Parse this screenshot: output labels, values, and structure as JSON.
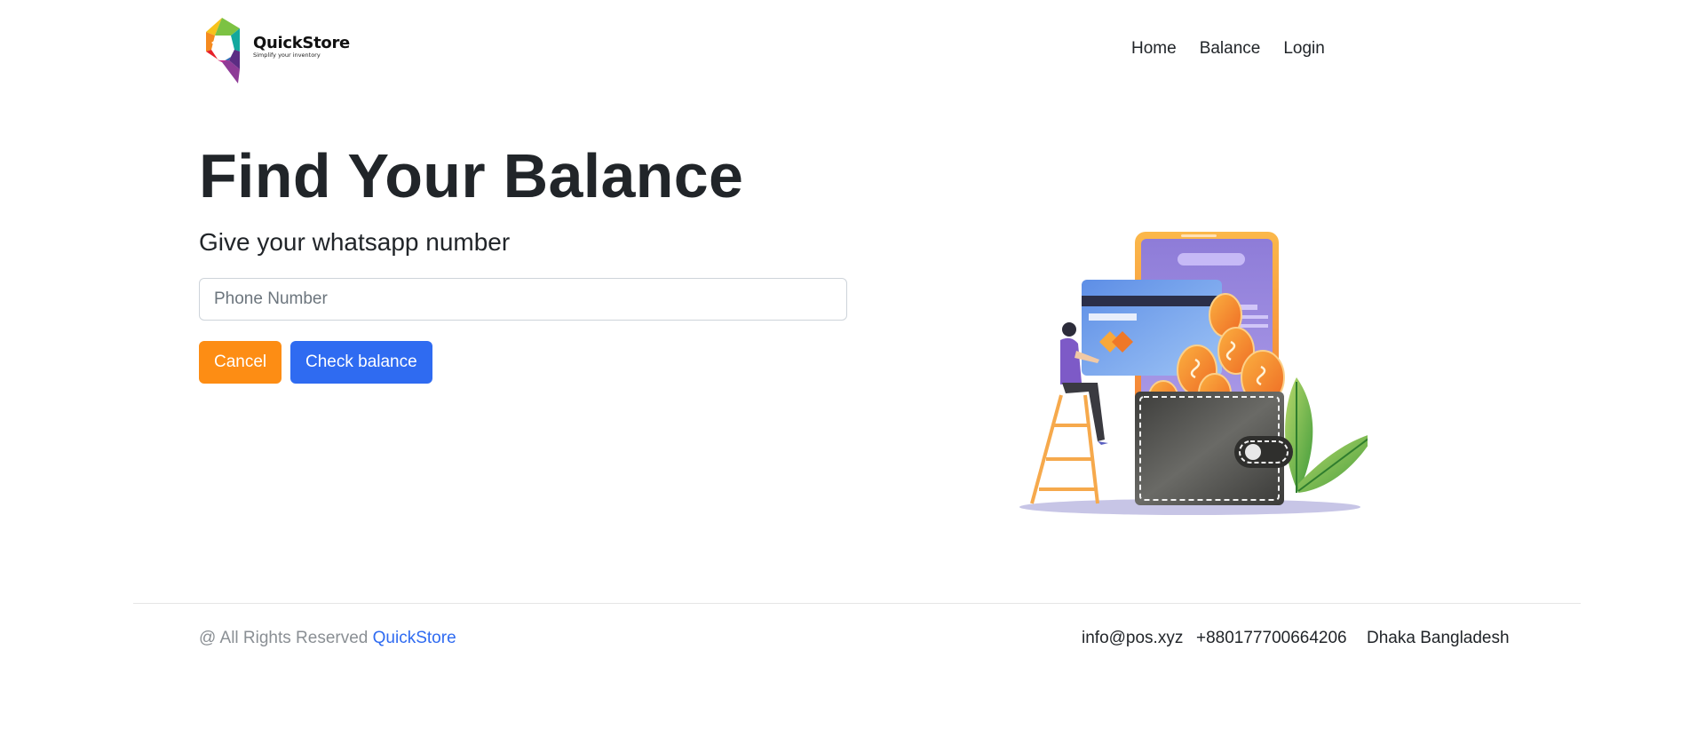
{
  "brand": {
    "name": "QuickStore",
    "tagline": "Simplify your inventory"
  },
  "nav": {
    "items": [
      {
        "label": "Home"
      },
      {
        "label": "Balance"
      },
      {
        "label": "Login"
      }
    ]
  },
  "main": {
    "title": "Find Your Balance",
    "subtitle": "Give your whatsapp number",
    "phone_placeholder": "Phone Number",
    "phone_value": "",
    "cancel_label": "Cancel",
    "check_label": "Check balance"
  },
  "footer": {
    "copyright_prefix": "@ All Rights Reserved",
    "copyright_brand": "QuickStore",
    "email": "info@pos.xyz",
    "phone": "+880177700664206",
    "address": "Dhaka Bangladesh"
  },
  "colors": {
    "accent_blue": "#2f6bf1",
    "accent_orange": "#fd8d14",
    "text_dark": "#212529",
    "text_muted": "#8a8f94"
  },
  "icons": {
    "logo": "quickstore-hexagon-logo",
    "illustration": "wallet-coins-illustration"
  }
}
